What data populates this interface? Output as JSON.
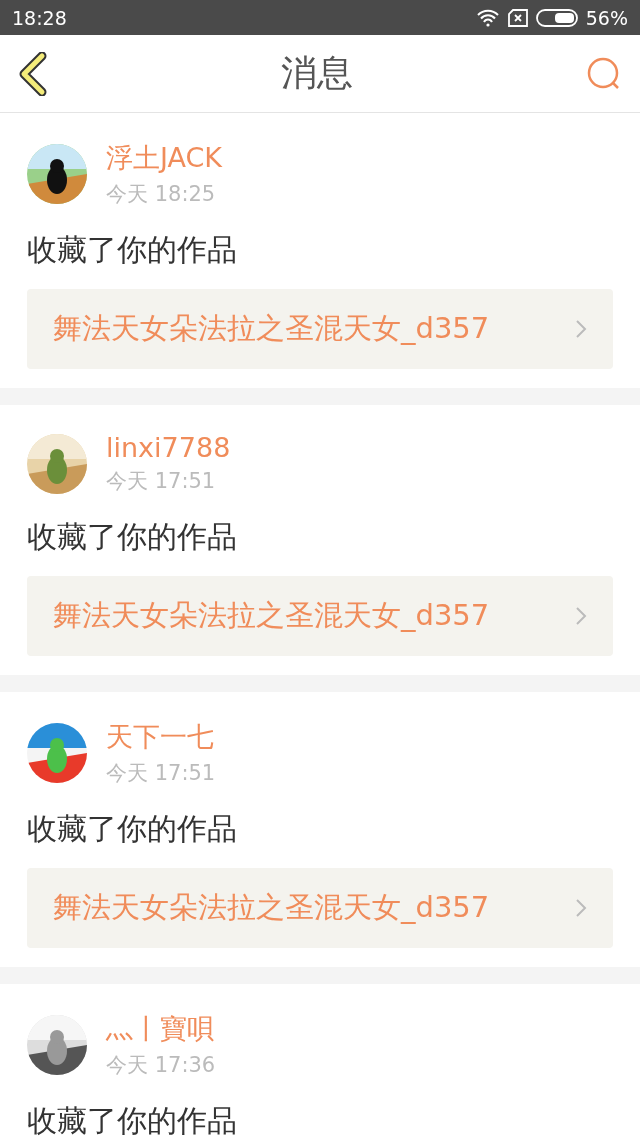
{
  "status_bar": {
    "time": "18:28",
    "battery": "56%"
  },
  "header": {
    "title": "消息"
  },
  "messages": [
    {
      "user": "浮土JACK",
      "time": "今天 18:25",
      "action": "收藏了你的作品",
      "work": "舞法天女朵法拉之圣混天女_d357"
    },
    {
      "user": "linxi7788",
      "time": "今天 17:51",
      "action": "收藏了你的作品",
      "work": "舞法天女朵法拉之圣混天女_d357"
    },
    {
      "user": "天下一七",
      "time": "今天 17:51",
      "action": "收藏了你的作品",
      "work": "舞法天女朵法拉之圣混天女_d357"
    },
    {
      "user": "灬丨寶唄",
      "time": "今天 17:36",
      "action": "收藏了你的作品"
    }
  ]
}
